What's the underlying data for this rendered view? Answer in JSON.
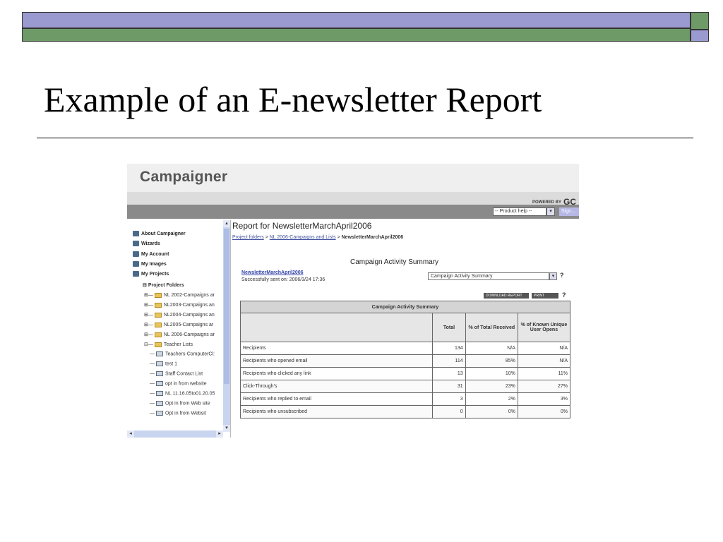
{
  "slide": {
    "title": "Example of an E-newsletter Report"
  },
  "app": {
    "brand": "Campaigner",
    "powered_prefix": "POWERED BY",
    "powered_brand": "GC",
    "help_select": "-- Product help --",
    "help_arrow": "▾",
    "signout": "Sign..."
  },
  "sidebar": {
    "menu": [
      {
        "label": "About Campaigner",
        "icon": "home-icon"
      },
      {
        "label": "Wizards",
        "icon": "wizard-icon"
      },
      {
        "label": "My Account",
        "icon": "account-icon"
      },
      {
        "label": "My Images",
        "icon": "images-icon"
      },
      {
        "label": "My Projects",
        "icon": "projects-icon"
      }
    ],
    "tree_root": "Project Folders",
    "folders": [
      "NL 2002-Campaigns ar",
      "NL2003-Campaigns an",
      "NL2004-Campaigns an",
      "NL2005-Campaigns ar",
      "NL 2006-Campaigns ar",
      "Teacher Lists"
    ],
    "lists": [
      "Teachers-ComputerCl:",
      "test 1",
      "Staff Contact List",
      "opt in from website",
      "NL 11.16.05to01.20.05",
      "Opt in from Web site",
      "Opt in from Websit"
    ]
  },
  "report": {
    "title": "Report for NewsletterMarchApril2006",
    "breadcrumb": {
      "first": "Project folders",
      "sep1": " > ",
      "second": "NL 2006-Campaigns and Lists",
      "sep2": " > ",
      "current": "NewsletterMarchApril2006"
    },
    "section_title": "Campaign Activity Summary",
    "campaign_link": "NewsletterMarchApril2006",
    "sent_text": "Successfully sent on: 2006/3/24 17:36",
    "view_select": "Campaign Activity Summary",
    "view_arrow": "▾",
    "help": "?",
    "download_button": "DOWNLOAD REPORT",
    "print_button": "PRINT",
    "table": {
      "caption": "Campaign Activity Summary",
      "columns": [
        "",
        "Total",
        "% of Total Received",
        "% of Known Unique User Opens"
      ],
      "rows": [
        [
          "Recipients",
          "134",
          "N/A",
          "N/A"
        ],
        [
          "Recipients who opened email",
          "114",
          "85%",
          "N/A"
        ],
        [
          "Recipients who clicked any link",
          "13",
          "10%",
          "11%"
        ],
        [
          "Click-Through's",
          "31",
          "23%",
          "27%"
        ],
        [
          "Recipients who replied to email",
          "3",
          "2%",
          "3%"
        ],
        [
          "Recipients who unsubscribed",
          "0",
          "0%",
          "0%"
        ]
      ]
    }
  }
}
